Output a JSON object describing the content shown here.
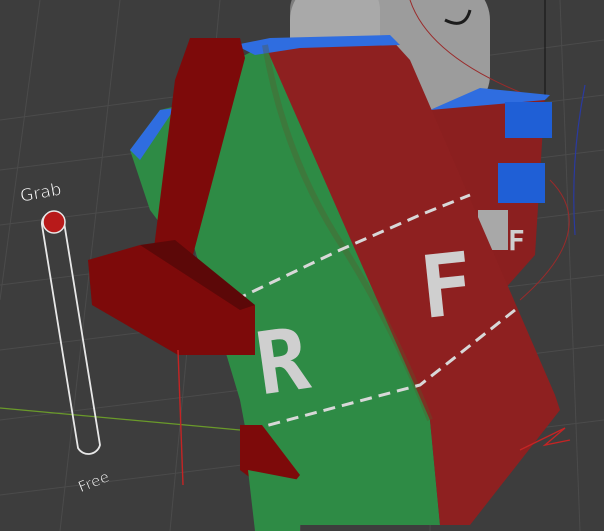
{
  "viewport": {
    "background_color": "#3d3d3d",
    "grid_color": "#4a4a4a"
  },
  "grab_slider": {
    "top_label": "Grab",
    "bottom_label": "Free",
    "handle_color": "#b81a1a",
    "track_color": "#e8e8e8",
    "level": 0.0
  },
  "cube": {
    "face_right_letter": "R",
    "face_front_letter": "F",
    "back_face_letter": "F",
    "right_face_color": "#2e8b45",
    "front_face_color": "#8e2020",
    "edge_highlight_color": "#2f6de0",
    "strap_color": "#7d0a0a",
    "seam_color": "#d8d8d8"
  },
  "character_head": {
    "color": "#9c9c9c"
  }
}
